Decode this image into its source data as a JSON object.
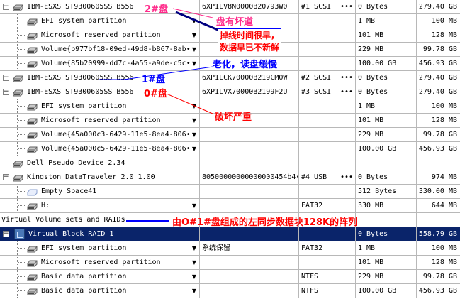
{
  "rows": [
    {
      "label": "IBM-ESXS ST9300605SS B556",
      "serial": "6XP1LV8N0000B20793W0",
      "bus": "#1 SCSI",
      "dots": "•••",
      "offset": "0 Bytes",
      "size": "279.40 GB",
      "icon": "disk-icon"
    },
    {
      "label": "EFI system partition",
      "serial": "",
      "bus": "",
      "offset": "1 MB",
      "size": "100 MB",
      "icon": "partition-icon",
      "dropdown": true
    },
    {
      "label": "Microsoft reserved partition",
      "serial": "",
      "bus": "",
      "offset": "101 MB",
      "size": "128 MB",
      "icon": "partition-icon",
      "dropdown": true
    },
    {
      "label": "Volume{b977bf18-09ed-49d8-b867-8ab•",
      "serial": "",
      "bus": "",
      "offset": "229 MB",
      "size": "99.78 GB",
      "icon": "partition-icon",
      "dropdown": true
    },
    {
      "label": "Volume{85b20999-dd7c-4a55-a9de-c5c•",
      "serial": "",
      "bus": "",
      "offset": "100.00 GB",
      "size": "456.93 GB",
      "icon": "partition-icon",
      "dropdown": true
    },
    {
      "label": "IBM-ESXS ST9300605SS B556",
      "serial": "6XP1LCK70000B219CMOW",
      "bus": "#2 SCSI",
      "dots": "•••",
      "offset": "0 Bytes",
      "size": "279.40 GB",
      "icon": "disk-icon"
    },
    {
      "label": "IBM-ESXS ST9300605SS B556",
      "serial": "6XP1LVX70000B2199F2U",
      "bus": "#3 SCSI",
      "dots": "•••",
      "offset": "0 Bytes",
      "size": "279.40 GB",
      "icon": "disk-icon"
    },
    {
      "label": "EFI system partition",
      "serial": "",
      "bus": "",
      "offset": "1 MB",
      "size": "100 MB",
      "icon": "partition-icon",
      "dropdown": true
    },
    {
      "label": "Microsoft reserved partition",
      "serial": "",
      "bus": "",
      "offset": "101 MB",
      "size": "128 MB",
      "icon": "partition-icon",
      "dropdown": true
    },
    {
      "label": "Volume{45a000c3-6429-11e5-8ea4-806•",
      "serial": "",
      "bus": "",
      "offset": "229 MB",
      "size": "99.78 GB",
      "icon": "partition-icon",
      "dropdown": true
    },
    {
      "label": "Volume{45a000c5-6429-11e5-8ea4-806•",
      "serial": "",
      "bus": "",
      "offset": "100.00 GB",
      "size": "456.93 GB",
      "icon": "partition-icon",
      "dropdown": true
    },
    {
      "label": "Dell Pseudo Device 2.34",
      "serial": "",
      "bus": "",
      "offset": "",
      "size": "",
      "icon": "disk-icon"
    },
    {
      "label": "Kingston DataTraveler 2.0 1.00",
      "serial": "80500000000000000454b4•••",
      "bus": "#4 USB",
      "dots": "•••",
      "offset": "0 Bytes",
      "size": "974 MB",
      "icon": "disk-icon"
    },
    {
      "label": "Empty Space41",
      "serial": "",
      "bus": "",
      "offset": "512 Bytes",
      "size": "330.00 MB",
      "icon": "empty-space-icon"
    },
    {
      "label": "H:",
      "serial": "",
      "bus": "FAT32",
      "offset": "330 MB",
      "size": "644 MB",
      "icon": "partition-icon",
      "dropdown": true
    },
    {
      "label": "Virtual Volume sets and RAIDs",
      "serial": "",
      "bus": "",
      "offset": "",
      "size": "",
      "icon": ""
    },
    {
      "label": "Virtual Block RAID 1",
      "serial": "",
      "bus": "",
      "offset": "0 Bytes",
      "size": "558.79 GB",
      "icon": "raid-icon",
      "selected": true
    },
    {
      "label": "EFI system partition",
      "serial": "系统保留",
      "bus": "FAT32",
      "offset": "1 MB",
      "size": "100 MB",
      "icon": "partition-icon",
      "dropdown": true
    },
    {
      "label": "Microsoft reserved partition",
      "serial": "",
      "bus": "",
      "offset": "101 MB",
      "size": "128 MB",
      "icon": "partition-icon",
      "dropdown": true
    },
    {
      "label": "Basic data partition",
      "serial": "",
      "bus": "NTFS",
      "offset": "229 MB",
      "size": "99.78 GB",
      "icon": "partition-icon",
      "dropdown": true
    },
    {
      "label": "Basic data partition",
      "serial": "",
      "bus": "NTFS",
      "offset": "100.00 GB",
      "size": "456.93 GB",
      "icon": "partition-icon",
      "dropdown": true
    }
  ],
  "annotations": {
    "disk2": "2#盘",
    "bad_sectors": "盘有坏道",
    "dropped_line1": "掉线时间很早，",
    "dropped_line2": "数据早已不新鲜",
    "aging": "老化，读盘缓慢",
    "disk1": "1#盘",
    "disk0": "0#盘",
    "severe": "破坏严重",
    "raid_note": "由O#1#盘组成的左同步数据块128K的阵列"
  },
  "colors": {
    "selection": "#0a246a",
    "annotation_red": "#ff0000",
    "annotation_pink": "#ff2a8a",
    "annotation_blue": "#0000ff"
  }
}
